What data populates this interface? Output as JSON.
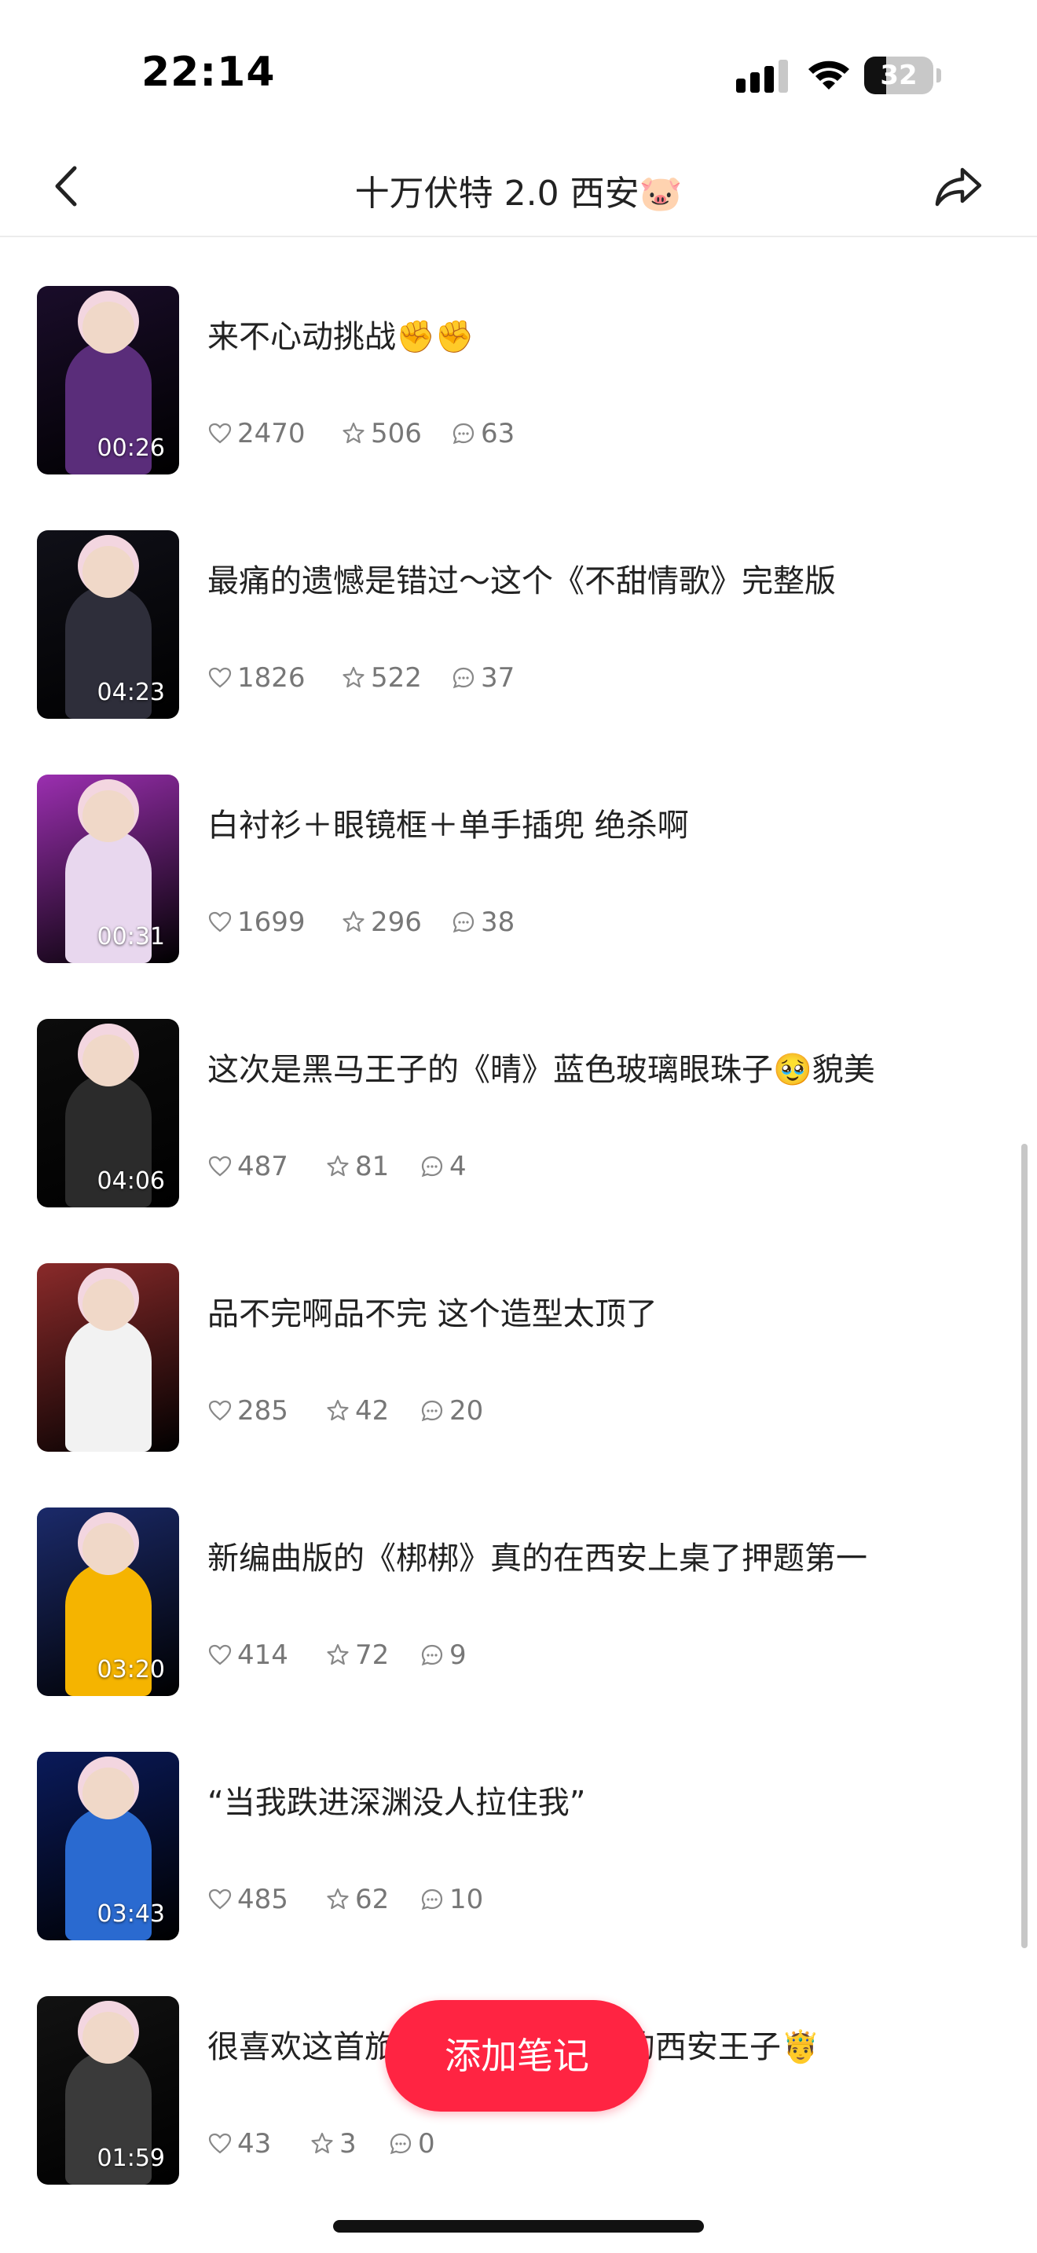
{
  "status_bar": {
    "time": "22:14",
    "battery": "32",
    "battery_level": 0.32
  },
  "nav": {
    "title": "十万伏特 2.0 西安🐷"
  },
  "items": [
    {
      "title": "来不心动挑战✊✊",
      "duration": "00:26",
      "likes": "2470",
      "stars": "506",
      "comments": "63",
      "thumb_bg": "#1a0d2a",
      "thumb_accent": "#5a2d7a"
    },
    {
      "title": "最痛的遗憾是错过～这个《不甜情歌》完整版",
      "duration": "04:23",
      "likes": "1826",
      "stars": "522",
      "comments": "37",
      "thumb_bg": "#101018",
      "thumb_accent": "#2e2e3a"
    },
    {
      "title": "白衬衫＋眼镜框＋单手插兜 绝杀啊",
      "duration": "00:31",
      "likes": "1699",
      "stars": "296",
      "comments": "38",
      "thumb_bg": "#9b2fb0",
      "thumb_accent": "#e8d7ee"
    },
    {
      "title": "这次是黑马王子的《晴》蓝色玻璃眼珠子🥹貌美",
      "duration": "04:06",
      "likes": "487",
      "stars": "81",
      "comments": "4",
      "thumb_bg": "#0c0c0c",
      "thumb_accent": "#2b2b2b"
    },
    {
      "title": "品不完啊品不完 这个造型太顶了",
      "duration": "",
      "likes": "285",
      "stars": "42",
      "comments": "20",
      "thumb_bg": "#8a2a2a",
      "thumb_accent": "#f2f2f2"
    },
    {
      "title": "新编曲版的《梆梆》真的在西安上桌了押题第一",
      "duration": "03:20",
      "likes": "414",
      "stars": "72",
      "comments": "9",
      "thumb_bg": "#1b2a6a",
      "thumb_accent": "#f5b400"
    },
    {
      "title": "“当我跌进深渊没人拉住我”",
      "duration": "03:43",
      "likes": "485",
      "stars": "62",
      "comments": "10",
      "thumb_bg": "#0a1a5a",
      "thumb_accent": "#2a6ad0"
    },
    {
      "title": "很喜欢这首旅",
      "title_tail": "的西安王子🤴",
      "duration": "01:59",
      "likes": "43",
      "stars": "3",
      "comments": "0",
      "thumb_bg": "#121212",
      "thumb_accent": "#3a3a3a"
    }
  ],
  "fab": {
    "label": "添加笔记"
  },
  "icons": {
    "back": "chevron-left-icon",
    "share": "share-arrow-icon",
    "like": "heart-icon",
    "star": "star-icon",
    "comment": "comment-icon"
  }
}
